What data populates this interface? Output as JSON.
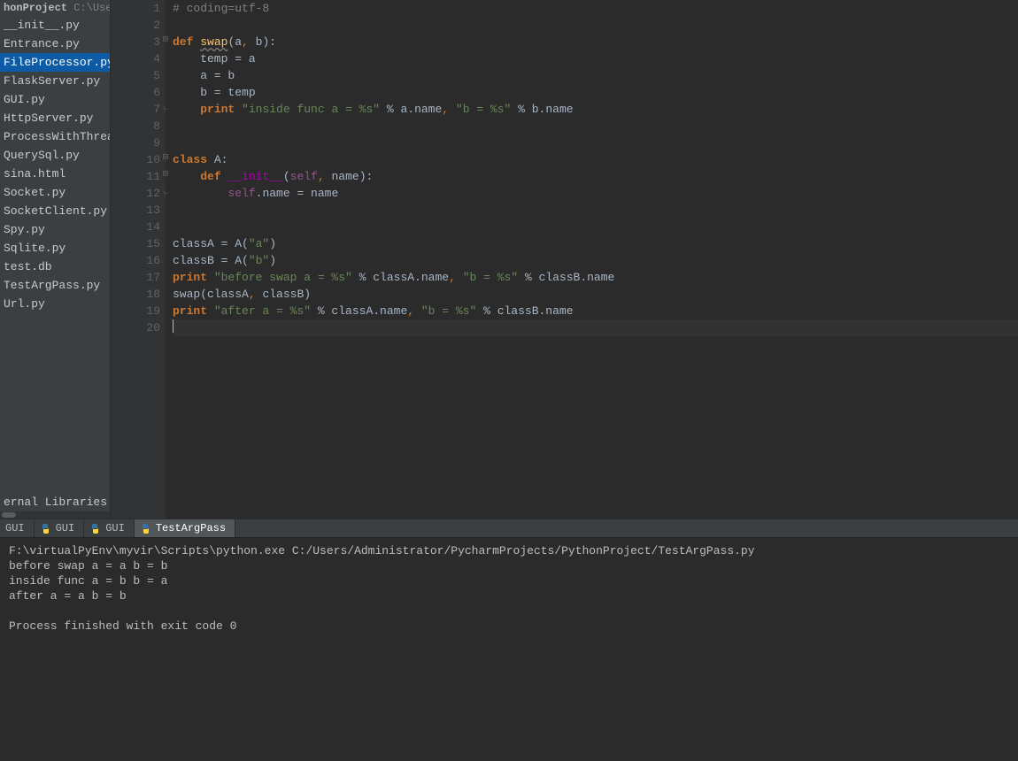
{
  "sidebar": {
    "root_name": "honProject",
    "root_path": "C:\\Users",
    "files": [
      {
        "name": "__init__.py",
        "selected": false
      },
      {
        "name": "Entrance.py",
        "selected": false
      },
      {
        "name": "FileProcessor.py",
        "selected": true
      },
      {
        "name": "FlaskServer.py",
        "selected": false
      },
      {
        "name": "GUI.py",
        "selected": false
      },
      {
        "name": "HttpServer.py",
        "selected": false
      },
      {
        "name": "ProcessWithThread.py",
        "selected": false
      },
      {
        "name": "QuerySql.py",
        "selected": false
      },
      {
        "name": "sina.html",
        "selected": false
      },
      {
        "name": "Socket.py",
        "selected": false
      },
      {
        "name": "SocketClient.py",
        "selected": false
      },
      {
        "name": "Spy.py",
        "selected": false
      },
      {
        "name": "Sqlite.py",
        "selected": false
      },
      {
        "name": "test.db",
        "selected": false
      },
      {
        "name": "TestArgPass.py",
        "selected": false
      },
      {
        "name": "Url.py",
        "selected": false
      }
    ],
    "external_libs": "ernal Libraries"
  },
  "editor": {
    "lines": [
      {
        "n": 1,
        "segs": [
          [
            "# coding=utf-8",
            "comment"
          ]
        ]
      },
      {
        "n": 2,
        "segs": [
          [
            "",
            ""
          ]
        ]
      },
      {
        "n": 3,
        "fold": "start",
        "segs": [
          [
            "def ",
            "keyword"
          ],
          [
            "swap",
            "def underline-wave"
          ],
          [
            "(a",
            "paren"
          ],
          [
            ",",
            "comma"
          ],
          [
            " b):",
            "paren"
          ]
        ]
      },
      {
        "n": 4,
        "segs": [
          [
            "    temp = a",
            "ident"
          ]
        ]
      },
      {
        "n": 5,
        "segs": [
          [
            "    a = b",
            "ident"
          ]
        ]
      },
      {
        "n": 6,
        "segs": [
          [
            "    b = temp",
            "ident"
          ]
        ]
      },
      {
        "n": 7,
        "fold": "end",
        "segs": [
          [
            "    ",
            ""
          ],
          [
            "print",
            "keyword"
          ],
          [
            " ",
            ""
          ],
          [
            "\"inside func a = %s\"",
            "str"
          ],
          [
            " % a.name",
            ""
          ],
          [
            ",",
            "comma"
          ],
          [
            " ",
            ""
          ],
          [
            "\"b = %s\"",
            "str"
          ],
          [
            " % b.name",
            ""
          ]
        ]
      },
      {
        "n": 8,
        "segs": [
          [
            "",
            ""
          ]
        ]
      },
      {
        "n": 9,
        "segs": [
          [
            "",
            ""
          ]
        ]
      },
      {
        "n": 10,
        "fold": "start",
        "segs": [
          [
            "class ",
            "keyword"
          ],
          [
            "A",
            "ident"
          ],
          [
            ":",
            ""
          ]
        ]
      },
      {
        "n": 11,
        "fold": "start",
        "segs": [
          [
            "    ",
            ""
          ],
          [
            "def ",
            "keyword"
          ],
          [
            "__init__",
            "dunder"
          ],
          [
            "(",
            ""
          ],
          [
            "self",
            "param-self"
          ],
          [
            ",",
            "comma"
          ],
          [
            " name):",
            ""
          ]
        ]
      },
      {
        "n": 12,
        "fold": "end",
        "segs": [
          [
            "        ",
            ""
          ],
          [
            "self",
            "param-self"
          ],
          [
            ".name = name",
            ""
          ]
        ]
      },
      {
        "n": 13,
        "segs": [
          [
            "",
            ""
          ]
        ]
      },
      {
        "n": 14,
        "segs": [
          [
            "",
            ""
          ]
        ]
      },
      {
        "n": 15,
        "segs": [
          [
            "classA = A(",
            ""
          ],
          [
            "\"a\"",
            "str"
          ],
          [
            ")",
            ""
          ]
        ]
      },
      {
        "n": 16,
        "segs": [
          [
            "classB = A(",
            ""
          ],
          [
            "\"b\"",
            "str"
          ],
          [
            ")",
            ""
          ]
        ]
      },
      {
        "n": 17,
        "segs": [
          [
            "print ",
            "keyword"
          ],
          [
            "\"before swap a = %s\"",
            "str"
          ],
          [
            " % classA.name",
            ""
          ],
          [
            ",",
            "comma"
          ],
          [
            " ",
            ""
          ],
          [
            "\"b = %s\"",
            "str"
          ],
          [
            " % classB.name",
            ""
          ]
        ]
      },
      {
        "n": 18,
        "segs": [
          [
            "swap(classA",
            ""
          ],
          [
            ",",
            "comma"
          ],
          [
            " classB)",
            ""
          ]
        ]
      },
      {
        "n": 19,
        "segs": [
          [
            "print ",
            "keyword"
          ],
          [
            "\"after a = %s\"",
            "str"
          ],
          [
            " % classA.name",
            ""
          ],
          [
            ",",
            "comma"
          ],
          [
            " ",
            ""
          ],
          [
            "\"b = %s\"",
            "str"
          ],
          [
            " % classB.name",
            ""
          ]
        ]
      },
      {
        "n": 20,
        "current": true,
        "caret": true,
        "segs": [
          [
            "",
            ""
          ]
        ]
      }
    ]
  },
  "console": {
    "tabs": [
      {
        "label": "GUI",
        "active": false,
        "noicon": true
      },
      {
        "label": "GUI",
        "active": false
      },
      {
        "label": "GUI",
        "active": false
      },
      {
        "label": "TestArgPass",
        "active": true
      }
    ],
    "output": "F:\\virtualPyEnv\\myvir\\Scripts\\python.exe C:/Users/Administrator/PycharmProjects/PythonProject/TestArgPass.py\nbefore swap a = a b = b\ninside func a = b b = a\nafter a = a b = b\n\nProcess finished with exit code 0"
  }
}
